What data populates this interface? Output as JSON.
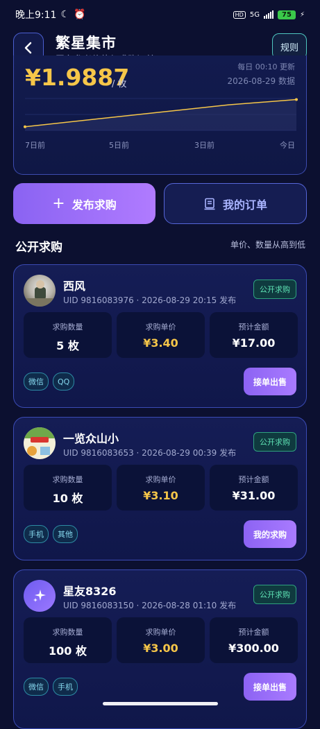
{
  "status_bar": {
    "time": "晚上9:11",
    "network": "5G",
    "battery": "75",
    "hd": "HD"
  },
  "header": {
    "title": "繁星集市",
    "subtitle": "平台参考价值与求购订单",
    "rules_label": "规则"
  },
  "price_card": {
    "price": "¥1.9887",
    "unit": "/ 枚",
    "update_note": "每日 00:10 更新",
    "data_date": "2026-08-29 数据"
  },
  "chart_data": {
    "type": "line",
    "x_tick_labels": [
      "7日前",
      "5日前",
      "3日前",
      "今日"
    ],
    "values": [
      1.84,
      1.88,
      1.92,
      1.96,
      1.9887
    ],
    "line_color": "#f6c649",
    "grid": true
  },
  "actions": {
    "publish_label": "发布求购",
    "orders_label": "我的订单"
  },
  "section": {
    "title": "公开求购",
    "sort_note": "单价、数量从高到低"
  },
  "labels": {
    "qty": "求购数量",
    "unit_price": "求购单价",
    "total": "预计金额",
    "badge": "公开求购"
  },
  "requests": [
    {
      "name": "西风",
      "meta": "UID 9816083976 · 2026-08-29 20:15 发布",
      "qty": "5 枚",
      "unit_price": "¥3.40",
      "total": "¥17.00",
      "tags": [
        "微信",
        "QQ"
      ],
      "action": "接单出售"
    },
    {
      "name": "一览众山小",
      "meta": "UID 9816083653 · 2026-08-29 00:39 发布",
      "qty": "10 枚",
      "unit_price": "¥3.10",
      "total": "¥31.00",
      "tags": [
        "手机",
        "其他"
      ],
      "action": "我的求购"
    },
    {
      "name": "星友8326",
      "meta": "UID 9816083150 · 2026-08-28 01:10 发布",
      "qty": "100 枚",
      "unit_price": "¥3.00",
      "total": "¥300.00",
      "tags": [
        "微信",
        "手机"
      ],
      "action": "接单出售"
    }
  ]
}
